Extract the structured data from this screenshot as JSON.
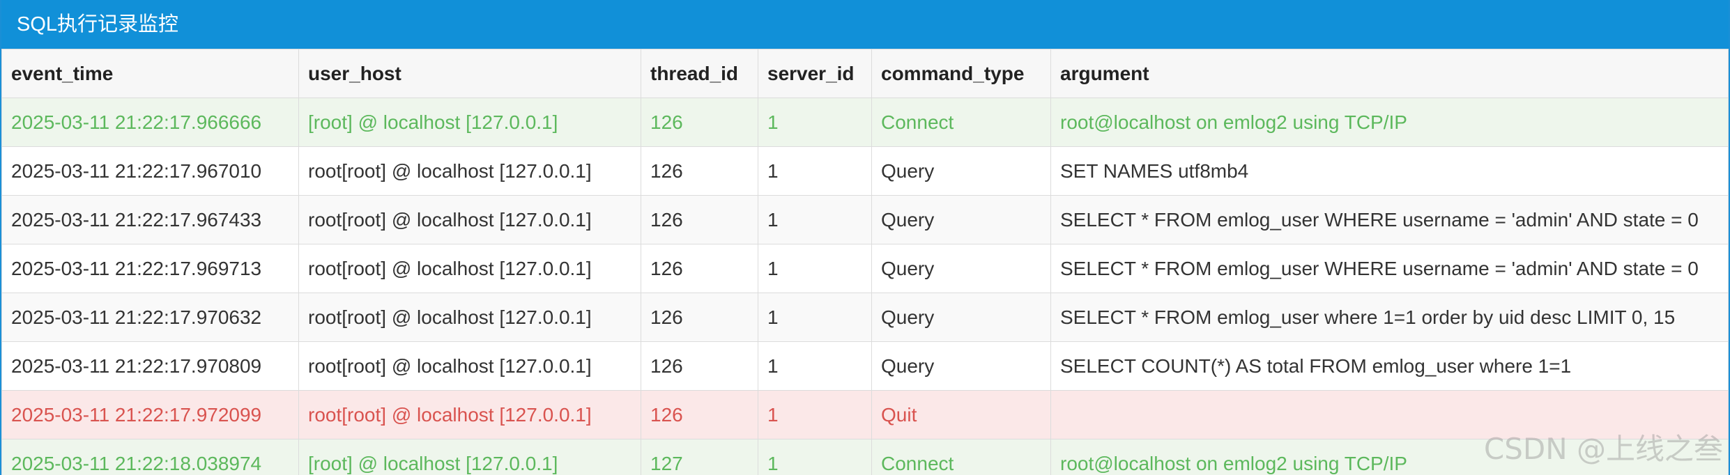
{
  "panel": {
    "title": "SQL执行记录监控"
  },
  "colors": {
    "header_bg": "#1190d8",
    "connect_text": "#5cb85c",
    "connect_bg": "#eef6ec",
    "quit_text": "#d9534f",
    "quit_bg": "#fbe8e8"
  },
  "table": {
    "columns": [
      "event_time",
      "user_host",
      "thread_id",
      "server_id",
      "command_type",
      "argument"
    ],
    "rows": [
      {
        "event_time": "2025-03-11 21:22:17.966666",
        "user_host": "[root] @ localhost [127.0.0.1]",
        "thread_id": "126",
        "server_id": "1",
        "command_type": "Connect",
        "argument": "root@localhost on emlog2 using TCP/IP",
        "status": "connect"
      },
      {
        "event_time": "2025-03-11 21:22:17.967010",
        "user_host": "root[root] @ localhost [127.0.0.1]",
        "thread_id": "126",
        "server_id": "1",
        "command_type": "Query",
        "argument": "SET NAMES utf8mb4",
        "status": "normal"
      },
      {
        "event_time": "2025-03-11 21:22:17.967433",
        "user_host": "root[root] @ localhost [127.0.0.1]",
        "thread_id": "126",
        "server_id": "1",
        "command_type": "Query",
        "argument": "SELECT * FROM emlog_user WHERE username = 'admin' AND state = 0",
        "status": "normal"
      },
      {
        "event_time": "2025-03-11 21:22:17.969713",
        "user_host": "root[root] @ localhost [127.0.0.1]",
        "thread_id": "126",
        "server_id": "1",
        "command_type": "Query",
        "argument": "SELECT * FROM emlog_user WHERE username = 'admin' AND state = 0",
        "status": "normal"
      },
      {
        "event_time": "2025-03-11 21:22:17.970632",
        "user_host": "root[root] @ localhost [127.0.0.1]",
        "thread_id": "126",
        "server_id": "1",
        "command_type": "Query",
        "argument": "SELECT * FROM emlog_user where 1=1 order by uid desc LIMIT 0, 15",
        "status": "normal"
      },
      {
        "event_time": "2025-03-11 21:22:17.970809",
        "user_host": "root[root] @ localhost [127.0.0.1]",
        "thread_id": "126",
        "server_id": "1",
        "command_type": "Query",
        "argument": "SELECT COUNT(*) AS total FROM emlog_user where 1=1",
        "status": "normal"
      },
      {
        "event_time": "2025-03-11 21:22:17.972099",
        "user_host": "root[root] @ localhost [127.0.0.1]",
        "thread_id": "126",
        "server_id": "1",
        "command_type": "Quit",
        "argument": "",
        "status": "quit"
      },
      {
        "event_time": "2025-03-11 21:22:18.038974",
        "user_host": "[root] @ localhost [127.0.0.1]",
        "thread_id": "127",
        "server_id": "1",
        "command_type": "Connect",
        "argument": "root@localhost on emlog2 using TCP/IP",
        "status": "connect"
      }
    ]
  },
  "watermark": "CSDN @上线之叁"
}
